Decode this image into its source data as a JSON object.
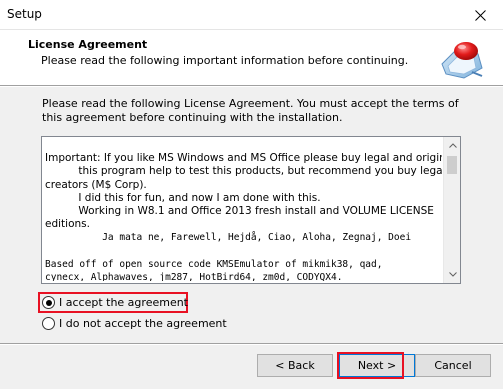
{
  "window": {
    "title": "Setup"
  },
  "header": {
    "title": "License Agreement",
    "subtitle": "Please read the following important information before continuing."
  },
  "intro": {
    "text": "Please read the following License Agreement. You must accept the terms of this agreement before continuing with the installation."
  },
  "license": {
    "lines": [
      "Important: If you like MS Windows and MS Office please buy legal and original",
      "          this program help to test this products, but recommend you buy legal from",
      "creators (M$ Corp).",
      "          I did this for fun, and now I am done with this.",
      "          Working in W8.1 and Office 2013 fresh install and VOLUME LICENSE",
      "editions.",
      "          Ja mata ne, Farewell, Hejdå, Ciao, Aloha, Zegnaj, Doei",
      "",
      "Based off of open source code KMSEmulator of mikmik38, qad,",
      "cynecx, Alphawaves, jm287, HotBird64, zm0d, CODYQX4."
    ]
  },
  "options": {
    "accept_label": "I accept the agreement",
    "decline_label": "I do not accept the agreement",
    "selected": "accept"
  },
  "buttons": {
    "back": "< Back",
    "next": "Next >",
    "cancel": "Cancel"
  },
  "colors": {
    "highlight": "#e81123",
    "focus": "#0078d7"
  }
}
